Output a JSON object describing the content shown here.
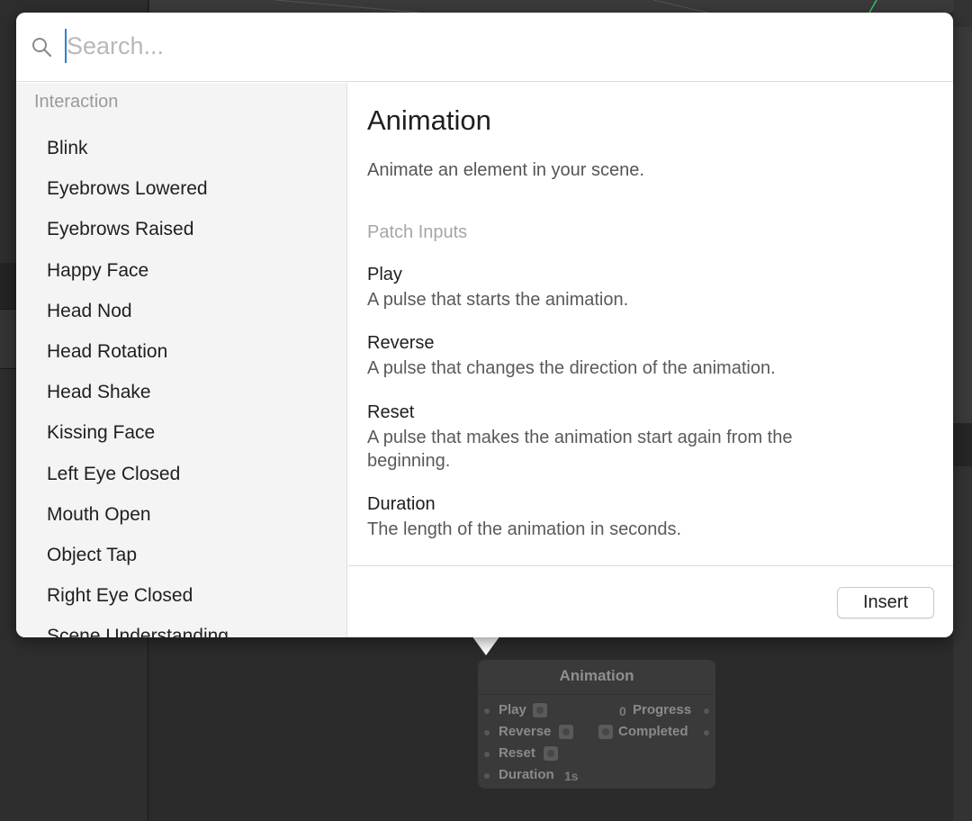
{
  "search": {
    "placeholder": "Search..."
  },
  "sidebar": {
    "heading": "Interaction",
    "items": [
      "Blink",
      "Eyebrows Lowered",
      "Eyebrows Raised",
      "Happy Face",
      "Head Nod",
      "Head Rotation",
      "Head Shake",
      "Kissing Face",
      "Left Eye Closed",
      "Mouth Open",
      "Object Tap",
      "Right Eye Closed",
      "Scene Understanding"
    ]
  },
  "detail": {
    "title": "Animation",
    "description": "Animate an element in your scene.",
    "inputs_heading": "Patch Inputs",
    "inputs": [
      {
        "name": "Play",
        "description": "A pulse that starts the animation."
      },
      {
        "name": "Reverse",
        "description": "A pulse that changes the direction of the animation."
      },
      {
        "name": "Reset",
        "description": "A pulse that makes the animation start again from the beginning."
      },
      {
        "name": "Duration",
        "description": "The length of the animation in seconds."
      }
    ]
  },
  "footer": {
    "insert_label": "Insert"
  },
  "node": {
    "title": "Animation",
    "inputs": [
      "Play",
      "Reverse",
      "Reset",
      "Duration"
    ],
    "duration_value": "1s",
    "outputs": [
      "Progress",
      "Completed"
    ],
    "progress_value": "0"
  },
  "colors": {
    "caret": "#2f7fd6",
    "editor_background": "#2b2b2b",
    "node_background": "#3a3a3a"
  },
  "icons": {
    "search": "search-icon"
  }
}
